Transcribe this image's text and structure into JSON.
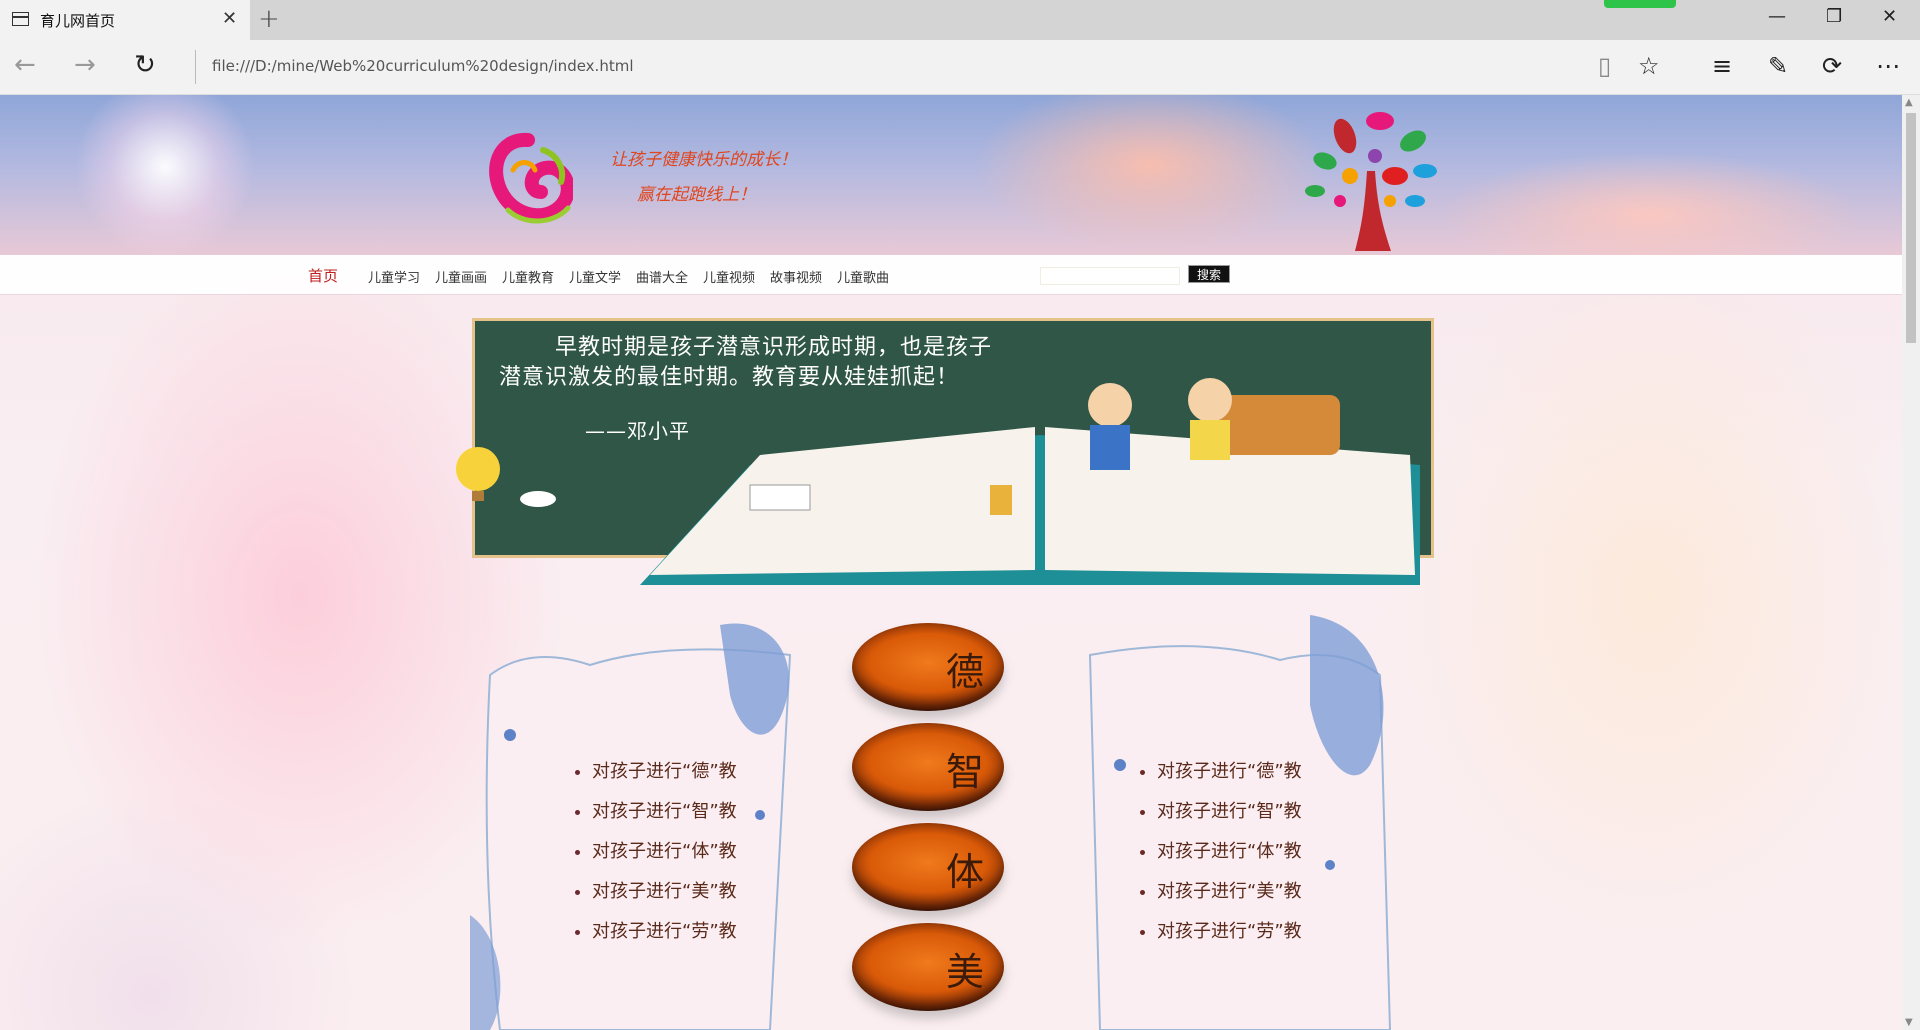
{
  "browser": {
    "tab_title": "育儿网首页",
    "url": "file:///D:/mine/Web%20curriculum%20design/index.html",
    "loading_progress": 1.0
  },
  "header": {
    "slogan_line1": "让孩子健康快乐的成长！",
    "slogan_line2": "赢在起跑线上！"
  },
  "nav": {
    "items": [
      "首页",
      "儿童学习",
      "儿童画画",
      "儿童教育",
      "儿童文学",
      "曲谱大全",
      "儿童视频",
      "故事视频",
      "儿童歌曲"
    ],
    "search_value": "",
    "search_button": "搜索"
  },
  "board": {
    "line1": "早教时期是孩子潜意识形成时期，也是孩子",
    "line2": "潜意识激发的最佳时期。教育要从娃娃抓起！",
    "author": "——邓小平"
  },
  "education": {
    "left_list": [
      "对孩子进行“德”教",
      "对孩子进行“智”教",
      "对孩子进行“体”教",
      "对孩子进行“美”教",
      "对孩子进行“劳”教"
    ],
    "right_list": [
      "对孩子进行“德”教",
      "对孩子进行“智”教",
      "对孩子进行“体”教",
      "对孩子进行“美”教",
      "对孩子进行“劳”教"
    ],
    "orbs": [
      "德",
      "智",
      "体",
      "美"
    ]
  },
  "colors": {
    "slogan": "#e0461e",
    "nav_active": "#c01e1e",
    "board": "#2f5647",
    "orb": "#e66a10",
    "list_text": "#5a2a1a"
  }
}
